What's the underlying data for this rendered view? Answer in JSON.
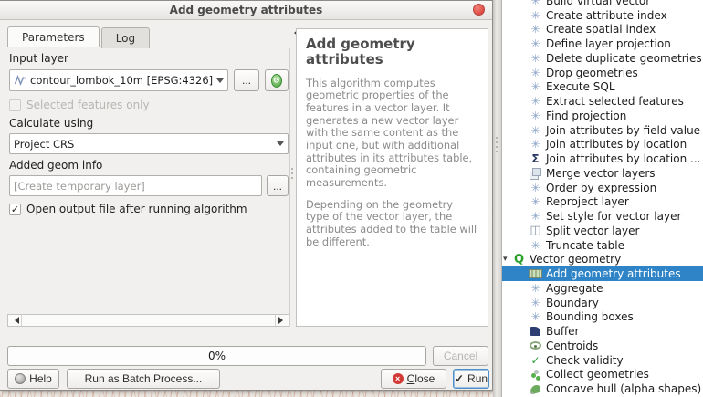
{
  "window": {
    "title": "Add geometry attributes"
  },
  "tabs": {
    "parameters": "Parameters",
    "log": "Log"
  },
  "form": {
    "input_layer_label": "Input layer",
    "input_layer_value": "contour_lombok_10m [EPSG:4326]",
    "browse_button": "...",
    "selected_features_label": "Selected features only",
    "calculate_using_label": "Calculate using",
    "calculate_using_value": "Project CRS",
    "added_geom_info_label": "Added geom info",
    "added_geom_info_value": "[Create temporary layer]",
    "open_output_label": "Open output file after running algorithm"
  },
  "description": {
    "heading": "Add geometry attributes",
    "para1": "This algorithm computes geometric properties of the features in a vector layer. It generates a new vector layer with the same content as the input one, but with additional attributes in its attributes table, containing geometric measurements.",
    "para2": "Depending on the geometry type of the vector layer, the attributes added to the table will be different."
  },
  "progress": {
    "label": "0%"
  },
  "buttons": {
    "cancel": "Cancel",
    "help": "Help",
    "batch": "Run as Batch Process...",
    "close": "Close",
    "run": "Run"
  },
  "colors": {
    "selection_blue": "#2e84c6",
    "titlebar_close_red": "#d5352b",
    "run_focus_border": "#4f8fc7",
    "gear_icon_blue": "#8aa2c6"
  },
  "toolbox": {
    "items": [
      {
        "label": "Build virtual vector",
        "icon": "gear-icon",
        "indent": 1
      },
      {
        "label": "Create attribute index",
        "icon": "gear-icon",
        "indent": 1
      },
      {
        "label": "Create spatial index",
        "icon": "gear-icon",
        "indent": 1
      },
      {
        "label": "Define layer projection",
        "icon": "gear-icon",
        "indent": 1
      },
      {
        "label": "Delete duplicate geometries",
        "icon": "gear-icon",
        "indent": 1
      },
      {
        "label": "Drop geometries",
        "icon": "gear-icon",
        "indent": 1
      },
      {
        "label": "Execute SQL",
        "icon": "gear-icon",
        "indent": 1
      },
      {
        "label": "Extract selected features",
        "icon": "gear-icon",
        "indent": 1
      },
      {
        "label": "Find projection",
        "icon": "gear-icon",
        "indent": 1
      },
      {
        "label": "Join attributes by field value",
        "icon": "gear-icon",
        "indent": 1
      },
      {
        "label": "Join attributes by location",
        "icon": "gear-icon",
        "indent": 1
      },
      {
        "label": "Join attributes by location ...",
        "icon": "sigma-icon",
        "indent": 1
      },
      {
        "label": "Merge vector layers",
        "icon": "merge-icon",
        "indent": 1
      },
      {
        "label": "Order by expression",
        "icon": "gear-icon",
        "indent": 1
      },
      {
        "label": "Reproject layer",
        "icon": "gear-icon",
        "indent": 1
      },
      {
        "label": "Set style for vector layer",
        "icon": "gear-icon",
        "indent": 1
      },
      {
        "label": "Split vector layer",
        "icon": "split-icon",
        "indent": 1
      },
      {
        "label": "Truncate table",
        "icon": "gear-icon",
        "indent": 1
      },
      {
        "label": "Vector geometry",
        "icon": "qgis-icon",
        "indent": 0,
        "group": true
      },
      {
        "label": "Add geometry attributes",
        "icon": "measure-icon",
        "indent": 1,
        "selected": true
      },
      {
        "label": "Aggregate",
        "icon": "gear-icon",
        "indent": 1
      },
      {
        "label": "Boundary",
        "icon": "gear-icon",
        "indent": 1
      },
      {
        "label": "Bounding boxes",
        "icon": "gear-icon",
        "indent": 1
      },
      {
        "label": "Buffer",
        "icon": "buffer-icon",
        "indent": 1
      },
      {
        "label": "Centroids",
        "icon": "centroid-icon",
        "indent": 1
      },
      {
        "label": "Check validity",
        "icon": "check-icon",
        "indent": 1
      },
      {
        "label": "Collect geometries",
        "icon": "collect-icon",
        "indent": 1
      },
      {
        "label": "Concave hull (alpha shapes)",
        "icon": "concave-icon",
        "indent": 1
      }
    ]
  }
}
